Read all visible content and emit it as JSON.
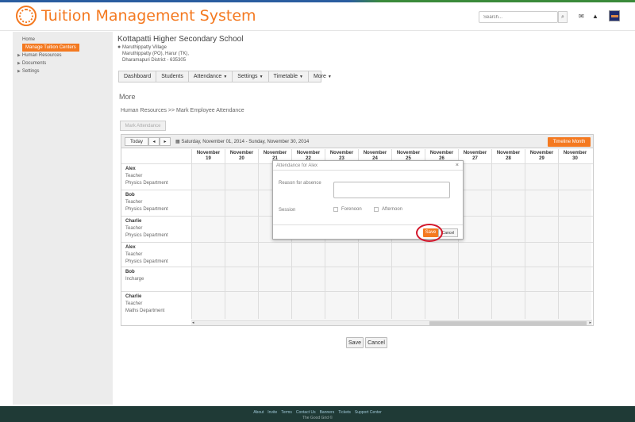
{
  "app": {
    "title": "Tuition Management System",
    "accent": "#f47920"
  },
  "header": {
    "search_placeholder": "Search...",
    "search_icon": "magnifier",
    "mail_icon": "envelope",
    "bell_icon": "bell"
  },
  "sidebar": {
    "items": [
      {
        "label": "Home"
      },
      {
        "label": "Manage Tuition  Centers",
        "active": true
      },
      {
        "label": "Human Resources",
        "expandable": true
      },
      {
        "label": "Documents",
        "expandable": true
      },
      {
        "label": "Settings",
        "expandable": true
      }
    ]
  },
  "school": {
    "name": "Kottapatti Higher Secondary School",
    "address1": "Maruthippatty Village",
    "address2": "Maruthippatty (PO), Harur (TK),",
    "address3": "Dharamapuri District - 635305"
  },
  "nav": {
    "items": [
      {
        "label": "Dashboard",
        "caret": false
      },
      {
        "label": "Students",
        "caret": false
      },
      {
        "label": "Attendance",
        "caret": true
      },
      {
        "label": "Settings",
        "caret": true
      },
      {
        "label": "Timetable",
        "caret": true
      },
      {
        "label": "More",
        "caret": true
      }
    ]
  },
  "page": {
    "title": "More",
    "breadcrumb": "Human Resources >> Mark Employee Attendance",
    "mark_button": "Mark Attendance"
  },
  "calendar": {
    "today": "Today",
    "prev": "◂",
    "next": "▸",
    "date_range": "Saturday, November 01, 2014 - Sunday, November 30, 2014",
    "timeline_button": "Timeline Month",
    "days": [
      {
        "month": "November",
        "day": "19"
      },
      {
        "month": "November",
        "day": "20"
      },
      {
        "month": "November",
        "day": "21"
      },
      {
        "month": "November",
        "day": "22"
      },
      {
        "month": "November",
        "day": "23"
      },
      {
        "month": "November",
        "day": "24"
      },
      {
        "month": "November",
        "day": "25"
      },
      {
        "month": "November",
        "day": "26"
      },
      {
        "month": "November",
        "day": "27"
      },
      {
        "month": "November",
        "day": "28"
      },
      {
        "month": "November",
        "day": "29"
      },
      {
        "month": "November",
        "day": "30"
      }
    ],
    "employees": [
      {
        "name": "Alex",
        "role": "Teacher",
        "dept": "Physics Department"
      },
      {
        "name": "Bob",
        "role": "Teacher",
        "dept": "Physics Department"
      },
      {
        "name": "Charlie",
        "role": "Teacher",
        "dept": "Physics Department"
      },
      {
        "name": "Alex",
        "role": "Teacher",
        "dept": "Physics Department"
      },
      {
        "name": "Bob",
        "role": "Incharge",
        "dept": ""
      },
      {
        "name": "Charlie",
        "role": "Teacher",
        "dept": "Maths Department"
      }
    ]
  },
  "dialog": {
    "title": "Attendance for Alex",
    "close": "×",
    "reason_label": "Reason for absence",
    "reason_value": "",
    "session_label": "Session",
    "forenoon": "Forenoon",
    "afternoon": "Afternoon",
    "save": "Save",
    "cancel": "Cancel"
  },
  "actions": {
    "save": "Save",
    "cancel": "Cancel"
  },
  "footer": {
    "links": [
      "About",
      "Invite",
      "Terms",
      "Contact Us",
      "Banners",
      "Tickets",
      "Support Center"
    ],
    "copyright": "The Good Grid ©"
  }
}
